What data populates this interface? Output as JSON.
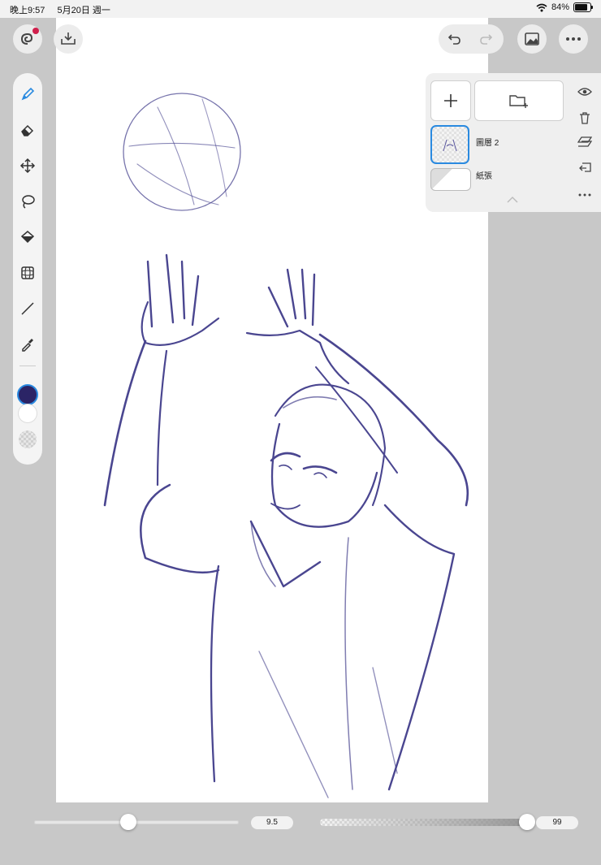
{
  "status_bar": {
    "time": "晚上9:57",
    "date": "5月20日 週一",
    "battery_percent": "84%",
    "battery_level": 0.84
  },
  "top_bar": {
    "icons": [
      "app-logo-icon",
      "import-icon",
      "undo-icon",
      "redo-icon",
      "gallery-icon",
      "more-icon"
    ]
  },
  "toolbar": {
    "tools": [
      "brush",
      "eraser",
      "move",
      "lasso",
      "fill",
      "transform",
      "line",
      "eyedropper"
    ],
    "active_tool": "brush",
    "primary_color": "#2b2466",
    "secondary_color": "#ffffff"
  },
  "layers": {
    "items": [
      {
        "name": "圖層 2",
        "selected": true
      },
      {
        "name": "紙張",
        "selected": false
      }
    ]
  },
  "bottom_bar": {
    "brush_size": "9.5",
    "opacity": "99",
    "brush_size_level": 0.46,
    "opacity_level": 0.99
  },
  "colors": {
    "accent": "#2a8ae0",
    "sketch_ink": "#4a4690"
  }
}
